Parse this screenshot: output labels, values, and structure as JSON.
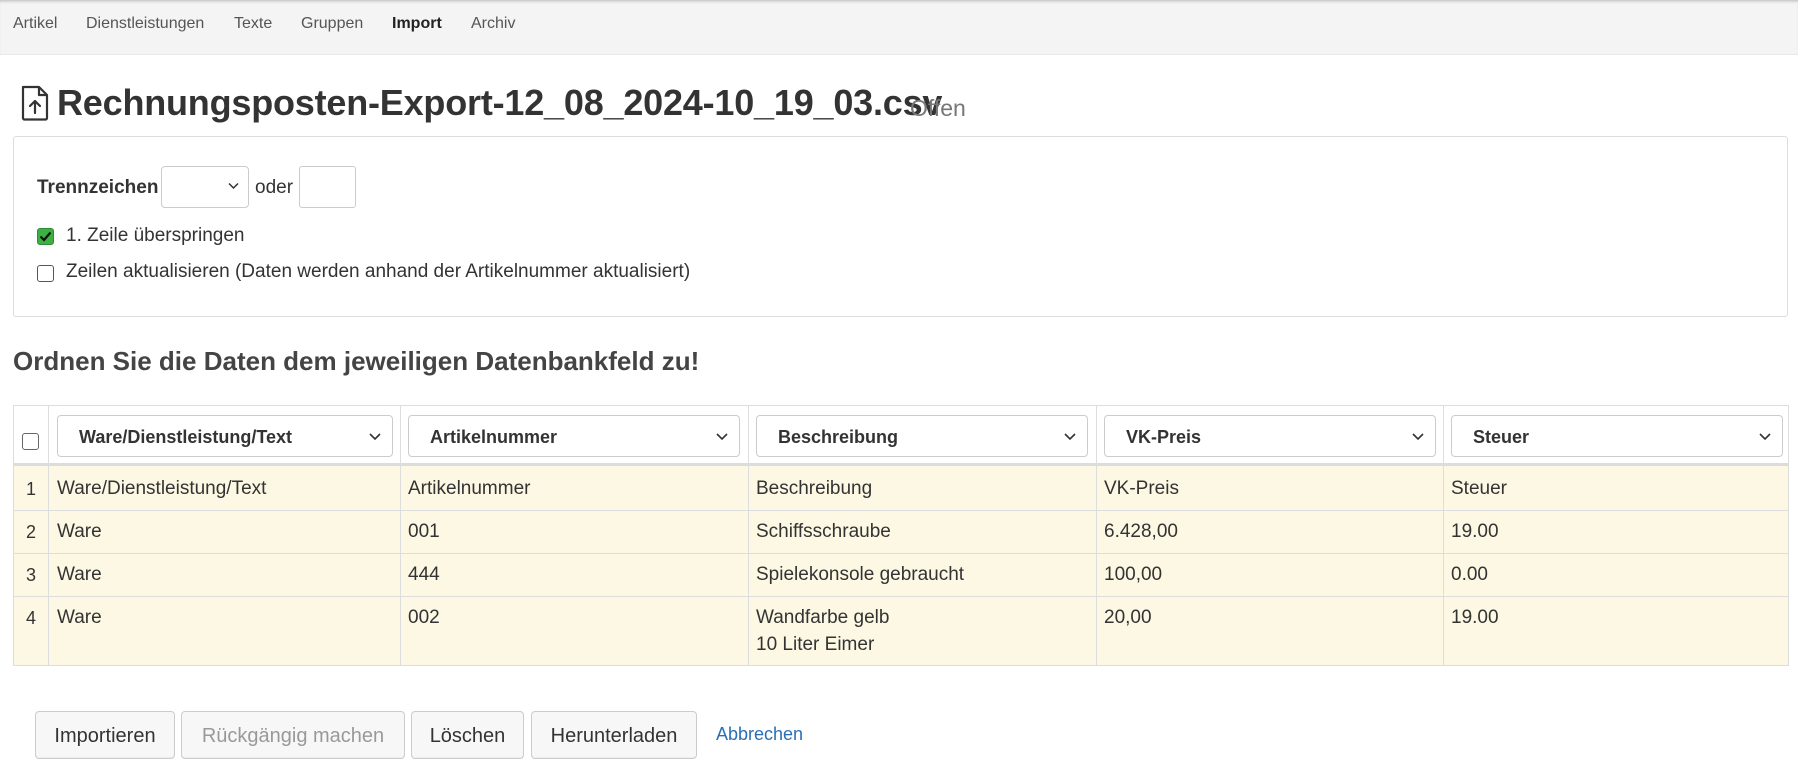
{
  "nav": {
    "items": [
      {
        "label": "Artikel",
        "active": false
      },
      {
        "label": "Dienstleistungen",
        "active": false
      },
      {
        "label": "Texte",
        "active": false
      },
      {
        "label": "Gruppen",
        "active": false
      },
      {
        "label": "Import",
        "active": true
      },
      {
        "label": "Archiv",
        "active": false
      }
    ]
  },
  "page": {
    "icon": "file-upload-icon",
    "title": "Rechnungsposten-Export-12_08_2024-10_19_03.csv",
    "status": "Offen"
  },
  "settings": {
    "delimiter_label": "Trennzeichen",
    "delimiter_select_value": "",
    "or_label": "oder",
    "delimiter_custom_value": "",
    "skip_first_row": {
      "label": "1. Zeile überspringen",
      "checked": true
    },
    "update_rows": {
      "label": "Zeilen aktualisieren (Daten werden anhand der Artikelnummer aktualisiert)",
      "checked": false
    }
  },
  "mapping": {
    "heading": "Ordnen Sie die Daten dem jeweiligen Datenbankfeld zu!",
    "select_all_checked": false,
    "columns": [
      {
        "selected": "Ware/Dienstleistung/Text"
      },
      {
        "selected": "Artikelnummer"
      },
      {
        "selected": "Beschreibung"
      },
      {
        "selected": "VK-Preis"
      },
      {
        "selected": "Steuer"
      }
    ],
    "rows": [
      {
        "num": "1",
        "cells": [
          "Ware/Dienstleistung/Text",
          "Artikelnummer",
          "Beschreibung",
          "VK-Preis",
          "Steuer"
        ]
      },
      {
        "num": "2",
        "cells": [
          "Ware",
          "001",
          "Schiffsschraube",
          "6.428,00",
          "19.00"
        ]
      },
      {
        "num": "3",
        "cells": [
          "Ware",
          "444",
          "Spielekonsole gebraucht",
          "100,00",
          "0.00"
        ]
      },
      {
        "num": "4",
        "cells": [
          "Ware",
          "002",
          "Wandfarbe gelb",
          "20,00",
          "19.00"
        ],
        "description_line2": "10 Liter Eimer"
      }
    ],
    "row_highlight_color": "#fcf8e3"
  },
  "actions": {
    "import_label": "Importieren",
    "undo_label": "Rückgängig machen",
    "undo_disabled": true,
    "delete_label": "Löschen",
    "download_label": "Herunterladen",
    "cancel_label": "Abbrechen"
  },
  "colors": {
    "checkbox_checked": "#3cb043",
    "link": "#2a6fb5"
  }
}
